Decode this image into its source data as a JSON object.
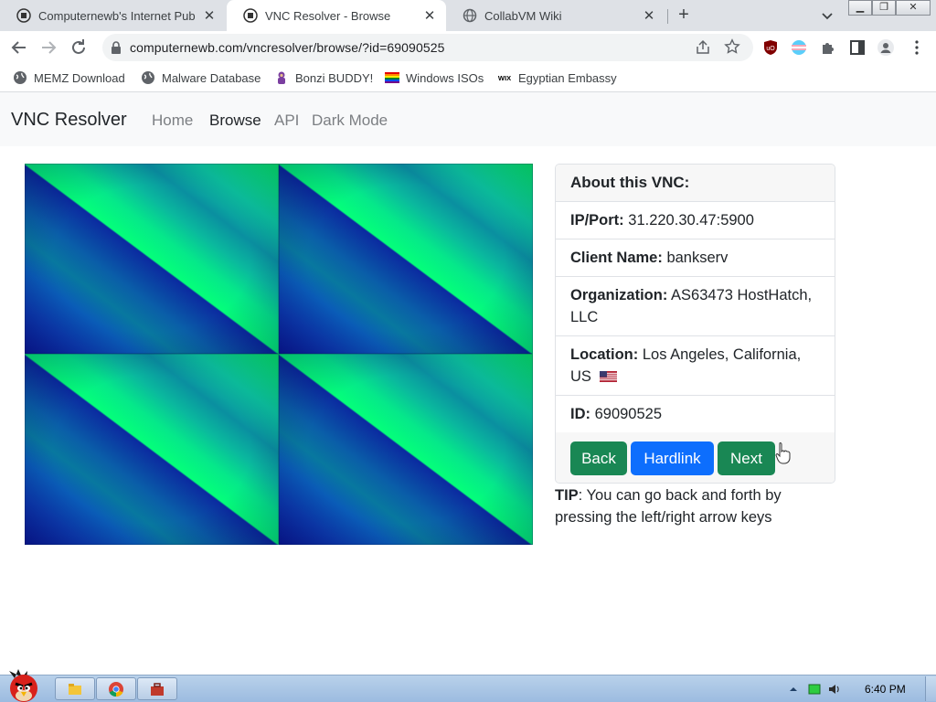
{
  "browser": {
    "tabs": [
      {
        "title": "Computernewb's Internet Pub",
        "active": false
      },
      {
        "title": "VNC Resolver - Browse",
        "active": true
      },
      {
        "title": "CollabVM Wiki",
        "active": false
      }
    ],
    "url": "computernewb.com/vncresolver/browse/?id=69090525"
  },
  "bookmarks": [
    {
      "label": "MEMZ Download",
      "icon": "globe-icon"
    },
    {
      "label": "Malware Database",
      "icon": "globe-icon"
    },
    {
      "label": "Bonzi BUDDY!",
      "icon": "bonzi-icon"
    },
    {
      "label": "Windows ISOs",
      "icon": "windows-flag-icon"
    },
    {
      "label": "Egyptian Embassy",
      "icon": "wix-icon"
    }
  ],
  "navbar": {
    "brand": "VNC Resolver",
    "links": [
      "Home",
      "Browse",
      "API",
      "Dark Mode"
    ],
    "active": "Browse"
  },
  "card": {
    "header": "About this VNC:",
    "items": [
      {
        "label": "IP/Port:",
        "value": "31.220.30.47:5900"
      },
      {
        "label": "Client Name:",
        "value": "bankserv"
      },
      {
        "label": "Organization:",
        "value": "AS63473 HostHatch, LLC"
      },
      {
        "label": "Location:",
        "value": "Los Angeles, California, US"
      },
      {
        "label": "ID:",
        "value": "69090525"
      }
    ],
    "buttons": {
      "back": "Back",
      "hardlink": "Hardlink",
      "next": "Next"
    }
  },
  "tip": {
    "label": "TIP",
    "text": ": You can go back and forth by pressing the left/right arrow keys"
  },
  "taskbar": {
    "time": "6:40 PM"
  },
  "colors": {
    "success": "#198754",
    "primary": "#0d6efd",
    "navbar_bg": "#f8f9fa"
  }
}
